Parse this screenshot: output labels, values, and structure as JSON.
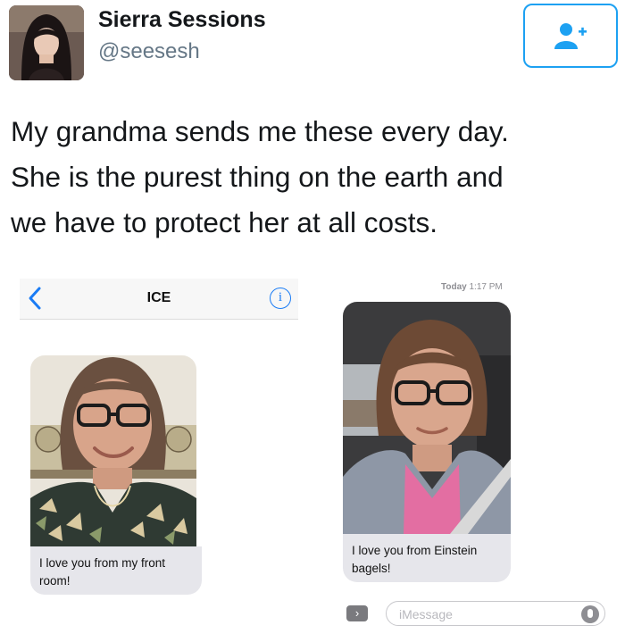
{
  "tweet": {
    "display_name": "Sierra Sessions",
    "handle": "@seesesh",
    "follow_icon": "add-user-icon",
    "text_lines": [
      "My grandma sends me these every day.",
      "She is the purest thing on the earth and",
      "we have to protect her at all costs."
    ]
  },
  "left_screenshot": {
    "back_icon": "chevron-left-icon",
    "contact_name": "ICE",
    "info_label": "i",
    "message": "I love you from my front room!"
  },
  "right_screenshot": {
    "timestamp_day": "Today",
    "timestamp_time": "1:17 PM",
    "message": "I love you from Einstein bagels!",
    "camera_label": "›",
    "input_placeholder": "iMessage"
  },
  "colors": {
    "twitter_blue": "#1da1f2",
    "ios_blue": "#1a7cf5",
    "bubble_gray": "#e6e6eb"
  }
}
